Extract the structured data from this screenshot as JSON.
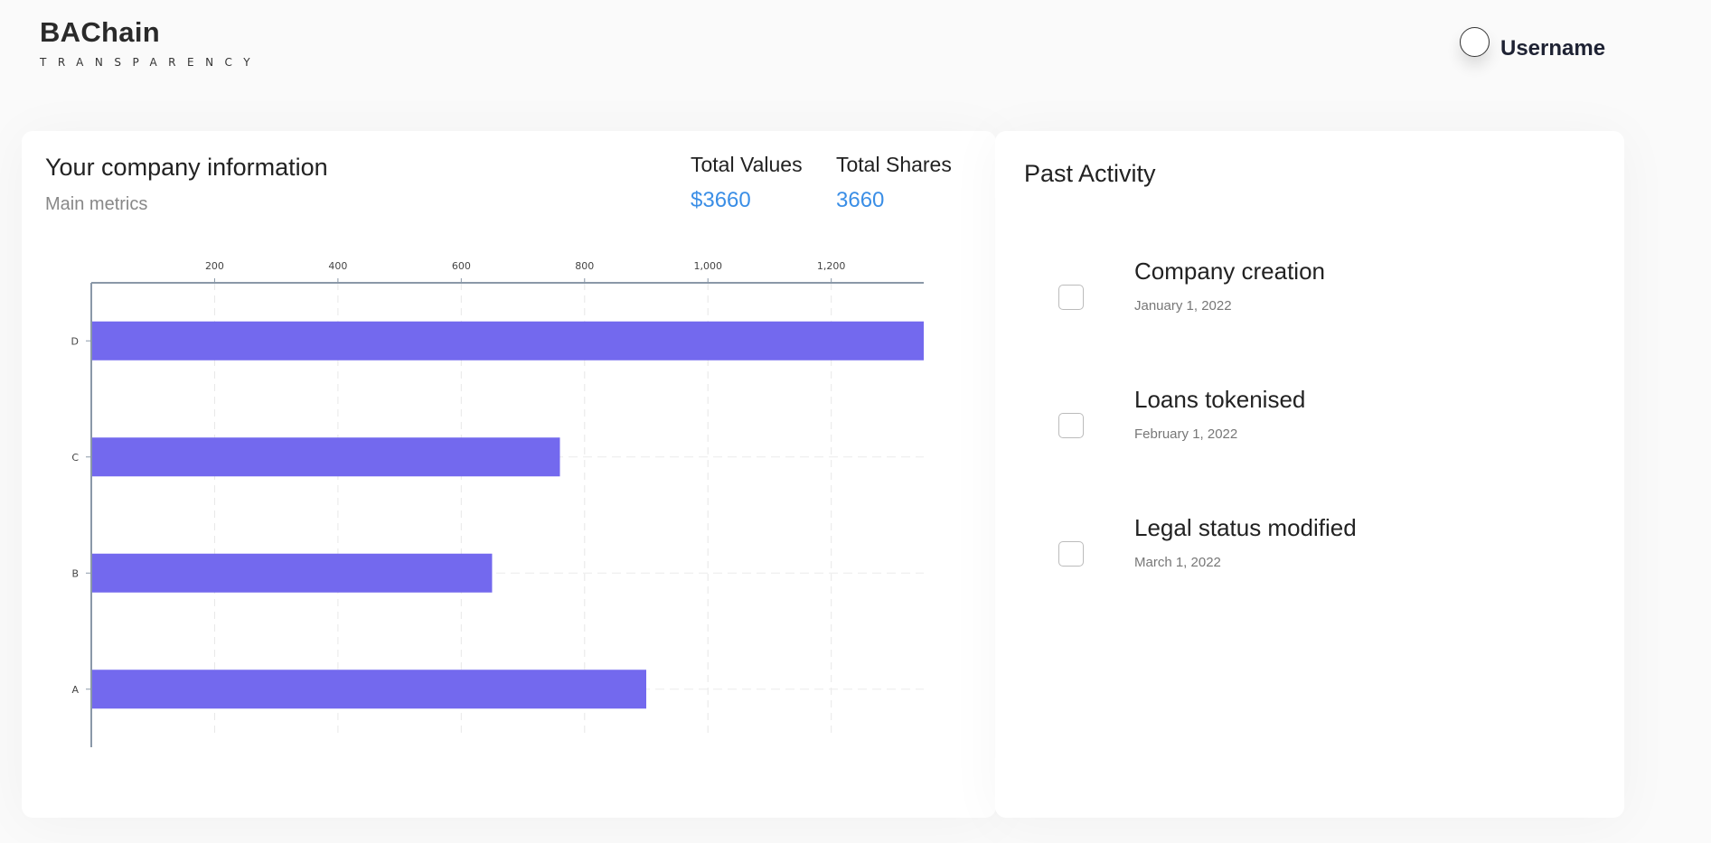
{
  "header": {
    "brand": "BAChain",
    "brand_sub": "TRANSPARENCY",
    "username": "Username"
  },
  "company": {
    "title": "Your company information",
    "subtitle": "Main metrics",
    "metrics": [
      {
        "label": "Total Values",
        "value": "$3660"
      },
      {
        "label": "Total Shares",
        "value": "3660"
      }
    ]
  },
  "colors": {
    "accent": "#3a8ee6",
    "bar": "#7369ee"
  },
  "chart_data": {
    "type": "bar",
    "orientation": "horizontal",
    "categories": [
      "D",
      "C",
      "B",
      "A"
    ],
    "values": [
      1350,
      760,
      650,
      900
    ],
    "xticks": [
      200,
      400,
      600,
      800,
      1000,
      1200
    ],
    "xtick_labels": [
      "200",
      "400",
      "600",
      "800",
      "1,000",
      "1,200"
    ],
    "xlim": [
      0,
      1350
    ],
    "xaxis_position": "top",
    "grid": true,
    "title": "",
    "xlabel": "",
    "ylabel": ""
  },
  "activity": {
    "title": "Past Activity",
    "items": [
      {
        "name": "Company creation",
        "date": "January 1, 2022"
      },
      {
        "name": "Loans tokenised",
        "date": "February 1, 2022"
      },
      {
        "name": "Legal status modified",
        "date": "March 1, 2022"
      }
    ]
  }
}
